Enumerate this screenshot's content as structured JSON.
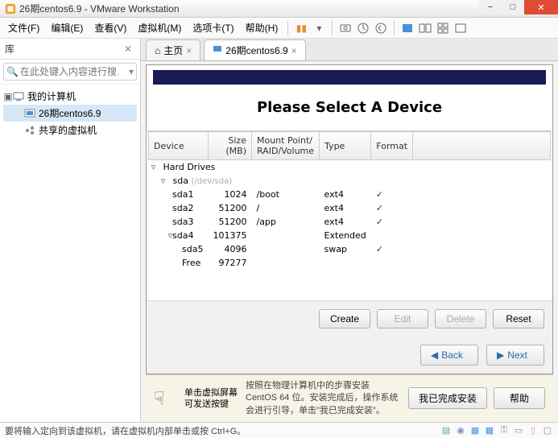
{
  "window": {
    "title": "26期centos6.9 - VMware Workstation"
  },
  "menu": {
    "file": "文件(F)",
    "edit": "编辑(E)",
    "view": "查看(V)",
    "vm": "虚拟机(M)",
    "tabs": "选项卡(T)",
    "help": "帮助(H)"
  },
  "sidebar": {
    "title": "库",
    "search_placeholder": "在此处键入内容进行搜...",
    "root": "我的计算机",
    "items": [
      "26期centos6.9",
      "共享的虚拟机"
    ]
  },
  "tabs": {
    "home": "主页",
    "vm": "26期centos6.9"
  },
  "installer": {
    "heading": "Please Select A Device",
    "columns": {
      "device": "Device",
      "size": "Size\n(MB)",
      "mount": "Mount Point/\nRAID/Volume",
      "type": "Type",
      "format": "Format"
    },
    "group": "Hard Drives",
    "disk_label": "sda",
    "disk_path": "(/dev/sda)",
    "rows": [
      {
        "name": "sda1",
        "size": "1024",
        "mount": "/boot",
        "type": "ext4",
        "fmt": true
      },
      {
        "name": "sda2",
        "size": "51200",
        "mount": "/",
        "type": "ext4",
        "fmt": true
      },
      {
        "name": "sda3",
        "size": "51200",
        "mount": "/app",
        "type": "ext4",
        "fmt": true
      },
      {
        "name": "sda4",
        "size": "101375",
        "mount": "",
        "type": "Extended",
        "fmt": false
      },
      {
        "name": "sda5",
        "size": "4096",
        "mount": "",
        "type": "swap",
        "fmt": true
      },
      {
        "name": "Free",
        "size": "97277",
        "mount": "",
        "type": "",
        "fmt": false
      }
    ],
    "buttons": {
      "create": "Create",
      "edit": "Edit",
      "delete": "Delete",
      "reset": "Reset",
      "back": "Back",
      "next": "Next"
    }
  },
  "hint": {
    "line1": "单击虚拟屏幕",
    "line2": "可发送按键",
    "msg": "按照在物理计算机中的步骤安装 CentOS 64 位。安装完成后，操作系统会进行引导，单击\"我已完成安装\"。",
    "done": "我已完成安装",
    "help": "帮助"
  },
  "status": {
    "msg": "要将输入定向到该虚拟机，请在虚拟机内部单击或按 Ctrl+G。"
  },
  "chart_data": {
    "type": "table",
    "title": "Please Select A Device — disk partitions",
    "columns": [
      "Device",
      "Size (MB)",
      "Mount Point/RAID/Volume",
      "Type",
      "Format"
    ],
    "rows": [
      [
        "sda1",
        1024,
        "/boot",
        "ext4",
        true
      ],
      [
        "sda2",
        51200,
        "/",
        "ext4",
        true
      ],
      [
        "sda3",
        51200,
        "/app",
        "ext4",
        true
      ],
      [
        "sda4",
        101375,
        "",
        "Extended",
        false
      ],
      [
        "sda5",
        4096,
        "",
        "swap",
        true
      ],
      [
        "Free",
        97277,
        "",
        "",
        false
      ]
    ]
  }
}
